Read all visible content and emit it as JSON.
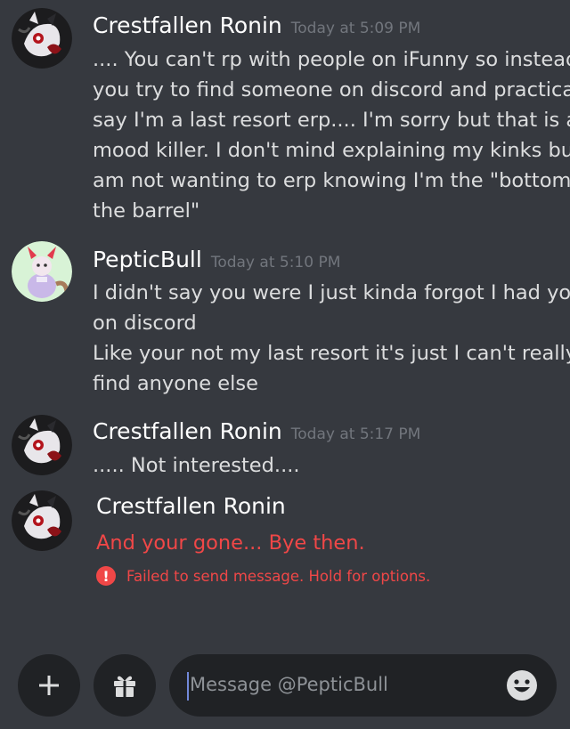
{
  "messages": [
    {
      "username": "Crestfallen Ronin",
      "timestamp": "Today at 5:09 PM",
      "lines": [
        ".... You can't rp with people on iFunny so instead",
        "you try to find someone on discord and practically",
        "say I'm a last resort erp.... I'm sorry but that is a",
        "mood killer.  I don't mind explaining my kinks but I",
        "am not wanting to erp knowing I'm the \"bottom of",
        "the barrel\""
      ],
      "avatar_icon": "dark-fox-avatar"
    },
    {
      "username": "PepticBull",
      "timestamp": "Today at 5:10 PM",
      "lines": [
        "I didn't say you were I just kinda forgot I had you",
        "on discord",
        "Like your not my last resort it's just I can't really",
        "find anyone else"
      ],
      "avatar_icon": "pastel-character-avatar"
    },
    {
      "username": "Crestfallen Ronin",
      "timestamp": "Today at 5:17 PM",
      "lines": [
        "..... Not interested...."
      ],
      "avatar_icon": "dark-fox-avatar"
    },
    {
      "username": "Crestfallen Ronin",
      "lines": [
        "And your gone...  Bye then."
      ],
      "failed": true,
      "error_icon": "!",
      "error_text": "Failed to send message. Hold for options.",
      "avatar_icon": "dark-fox-avatar"
    }
  ],
  "composer": {
    "add_icon": "plus-icon",
    "gift_icon": "gift-icon",
    "placeholder": "Message @PepticBull",
    "emoji_icon": "smiley-icon"
  },
  "colors": {
    "background": "#36393f",
    "input_background": "#202225",
    "username": "#ffffff",
    "message_text": "#dcddde",
    "timestamp": "#72767d",
    "error": "#f04747"
  }
}
